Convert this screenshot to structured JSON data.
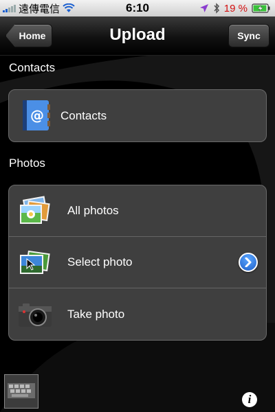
{
  "status_bar": {
    "carrier": "遠傳電信",
    "time": "6:10",
    "battery_percent": "19 %",
    "icons": [
      "signal-bars-icon",
      "wifi-icon",
      "location-arrow-icon",
      "bluetooth-icon",
      "battery-charging-icon"
    ]
  },
  "nav": {
    "title": "Upload",
    "back_label": "Home",
    "right_label": "Sync"
  },
  "sections": {
    "contacts": {
      "header": "Contacts",
      "rows": [
        {
          "label": "Contacts",
          "icon": "address-book-icon"
        }
      ]
    },
    "photos": {
      "header": "Photos",
      "rows": [
        {
          "label": "All photos",
          "icon": "photo-stack-icon"
        },
        {
          "label": "Select photo",
          "icon": "select-photo-icon",
          "accessory": "chevron-right-circle-icon"
        },
        {
          "label": "Take photo",
          "icon": "camera-icon"
        }
      ]
    }
  },
  "footer": {
    "info_glyph": "i",
    "thumbnail_icon": "photo-thumbnail-icon"
  },
  "colors": {
    "background": "#000000",
    "cell_background": "#3f3f3f",
    "accessory_blue": "#1e5fc8",
    "battery_low": "#d41010"
  }
}
